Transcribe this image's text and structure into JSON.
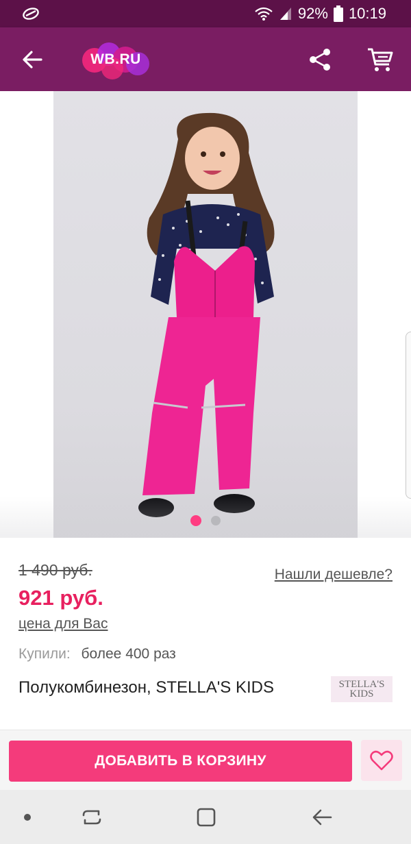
{
  "status_bar": {
    "battery": "92%",
    "time": "10:19"
  },
  "app_bar": {
    "logo_text": "WB.RU"
  },
  "gallery": {
    "image_count": 2,
    "active_index": 0
  },
  "product": {
    "old_price": "1 490 руб.",
    "new_price": "921 руб.",
    "your_price_link": "цена для Вас",
    "cheaper_link": "Нашли дешевле?",
    "bought_label": "Купили:",
    "bought_value": "более 400 раз",
    "title": "Полукомбинезон, STELLA'S KIDS",
    "brand_logo_line1": "STELLA'S",
    "brand_logo_line2": "KIDS"
  },
  "actions": {
    "add_to_cart": "ДОБАВИТЬ В КОРЗИНУ"
  },
  "colors": {
    "status_bar": "#5c1148",
    "app_bar": "#7a1d62",
    "accent": "#f43b7b",
    "price": "#e8205f"
  },
  "icons": [
    "notification-icon",
    "wifi-icon",
    "signal-icon",
    "battery-icon",
    "back-arrow-icon",
    "share-icon",
    "cart-icon",
    "heart-icon",
    "nav-dot-icon",
    "recent-apps-icon",
    "home-icon",
    "nav-back-icon"
  ]
}
